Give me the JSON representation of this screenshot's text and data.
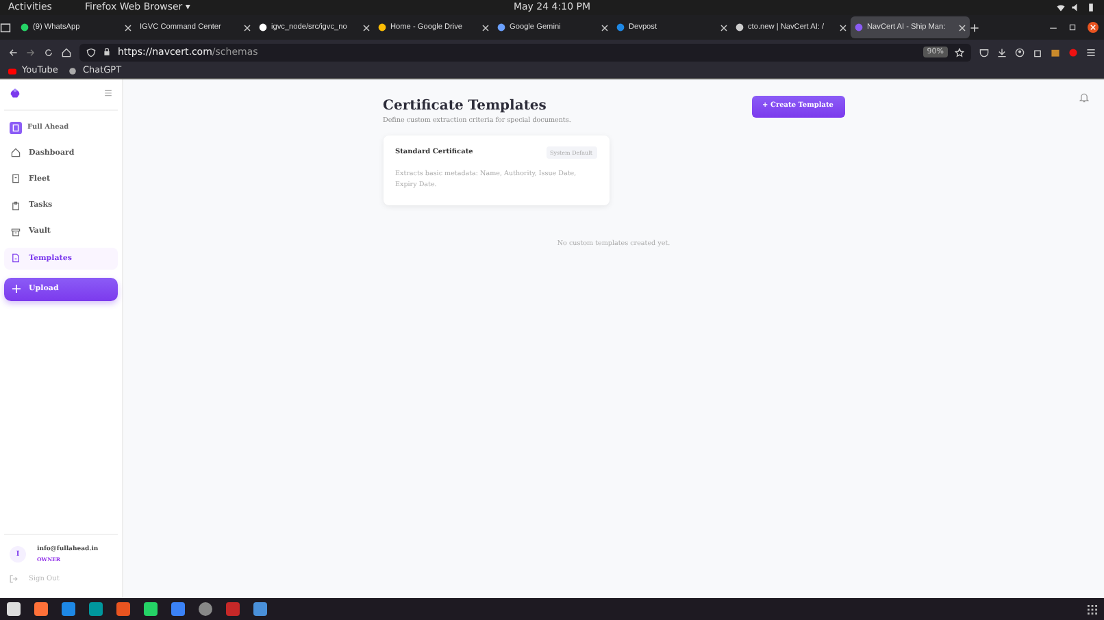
{
  "system_bar": {
    "activities": "Activities",
    "app_menu": "Firefox Web Browser ▾",
    "clock": "May 24  4:10 PM"
  },
  "browser": {
    "tabs": [
      {
        "title": "(9) WhatsApp",
        "selected": false
      },
      {
        "title": "IGVC Command Center",
        "selected": false
      },
      {
        "title": "igvc_node/src/igvc_no",
        "selected": false
      },
      {
        "title": "Home - Google Drive",
        "selected": false
      },
      {
        "title": "Google Gemini",
        "selected": false
      },
      {
        "title": "Devpost",
        "selected": false
      },
      {
        "title": "cto.new | NavCert AI: /",
        "selected": false
      },
      {
        "title": "NavCert AI - Ship Man:",
        "selected": true
      }
    ],
    "url_host": "https://navcert.com",
    "url_path": "/schemas",
    "zoom": "90%",
    "bookmarks": [
      {
        "label": "YouTube"
      },
      {
        "label": "ChatGPT"
      }
    ]
  },
  "sidebar": {
    "org": "Full Ahead",
    "nav": [
      {
        "label": "Dashboard",
        "selected": false
      },
      {
        "label": "Fleet",
        "selected": false
      },
      {
        "label": "Tasks",
        "selected": false
      },
      {
        "label": "Vault",
        "selected": false
      },
      {
        "label": "Templates",
        "selected": true
      }
    ],
    "upload": "Upload",
    "user": {
      "initial": "I",
      "email": "info@fullahead.in",
      "role": "OWNER"
    },
    "sign_out": "Sign Out"
  },
  "page": {
    "title": "Certificate Templates",
    "subtitle": "Define custom extraction criteria for special documents.",
    "create_button": "+ Create Template",
    "templates": [
      {
        "name": "Standard Certificate",
        "badge": "System Default",
        "description": "Extracts basic metadata: Name, Authority, Issue Date, Expiry Date."
      }
    ],
    "empty_message": "No custom templates created yet."
  }
}
